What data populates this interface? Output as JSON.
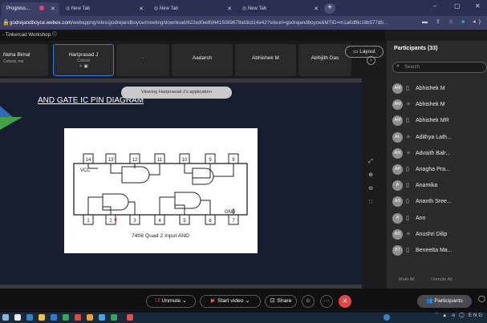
{
  "browser": {
    "tabs": [
      {
        "label": "Progress...",
        "active": true
      },
      {
        "label": "New Tab"
      },
      {
        "label": "New Tab"
      },
      {
        "label": "New Tab"
      }
    ],
    "url_domain": "godrejandboyce.webex.com",
    "url_path": "/webappng/sites/godrejandboyce/meeting/download/622ed0edfd4415089679afdcd14e42?siteurl=godrejandboyce&MTID=m1a6df8c18b577db..."
  },
  "meeting": {
    "title": "- Tinkercad Workshop ⓘ",
    "layout_label": "Layout",
    "sharing_notice": "Viewing Hariprasad J's application"
  },
  "strip": {
    "tiles": [
      {
        "name": "Neha Bimal",
        "sub": "Cohost, me"
      },
      {
        "name": "Hariprasad J",
        "sub": "Cohost",
        "icons": "✧ ▣"
      },
      {
        "name": "·",
        "sub": ""
      },
      {
        "name": "Aadarsh",
        "sub": ""
      },
      {
        "name": "Abhishek M",
        "sub": ""
      },
      {
        "name": "Abhijith Das",
        "sub": ""
      }
    ]
  },
  "slide": {
    "title": "AND GATE IC PIN DIAGRAM",
    "chip": {
      "top_pins": [
        "14",
        "13",
        "12",
        "11",
        "10",
        "9",
        "8"
      ],
      "bottom_pins": [
        "1",
        "2",
        "3",
        "4",
        "5",
        "6",
        "7"
      ],
      "vcc": "VCC",
      "gnd": "GND",
      "caption": "7408 Quad 2 Input AND"
    }
  },
  "side_tools": [
    "⤢",
    "⊕",
    "⊖",
    "∷"
  ],
  "participants": {
    "title": "Participants (33)",
    "search_placeholder": "Search",
    "list": [
      {
        "initials": "AM",
        "status": "▯",
        "name": "Abhishek M"
      },
      {
        "initials": "AM",
        "status": "✧",
        "name": "Abhishek M"
      },
      {
        "initials": "AM",
        "status": "▯",
        "name": "Abhishek MR"
      },
      {
        "initials": "AL",
        "status": "✧",
        "name": "Adithya Lath..."
      },
      {
        "initials": "AN",
        "status": "✧",
        "name": "Advaith Balr..."
      },
      {
        "initials": "AP",
        "status": "▯",
        "name": "Anagha Pra..."
      },
      {
        "initials": "A",
        "status": "▯",
        "name": "Anamika"
      },
      {
        "initials": "AS",
        "status": "▯",
        "name": "Ananth Sree..."
      },
      {
        "initials": "A",
        "status": "▯",
        "name": "Ann"
      },
      {
        "initials": "AD",
        "status": "✧",
        "name": "Anushri Dilip"
      },
      {
        "initials": "BT",
        "status": "▯",
        "name": "Beneetta Ma..."
      }
    ],
    "mute_all": "Mute All",
    "unmute_all": "Unmute All"
  },
  "controls": {
    "unmute": "Unmute",
    "start_video": "Start video",
    "share": "Share",
    "participants": "Participants",
    "leave_icon": "✕"
  },
  "taskbar": {
    "tray": "⌃ ▲ ദ ◯ ENG"
  }
}
